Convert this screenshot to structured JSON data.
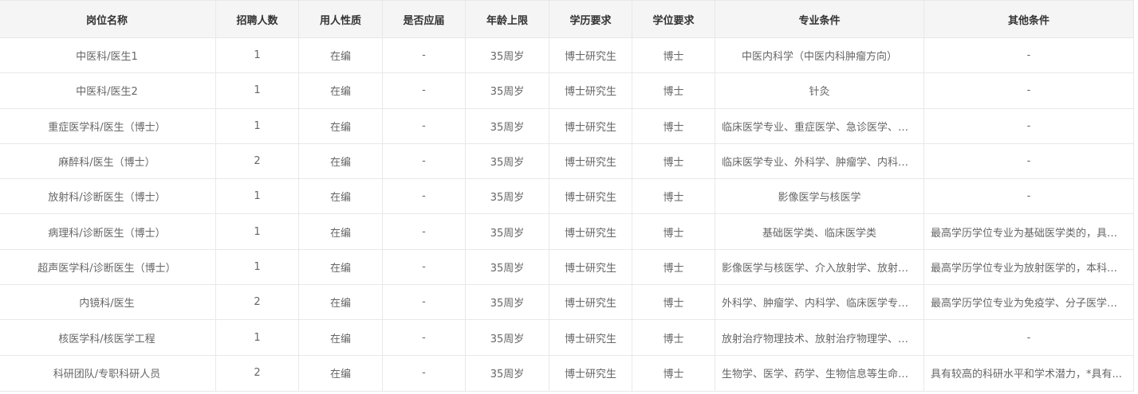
{
  "columns": [
    "岗位名称",
    "招聘人数",
    "用人性质",
    "是否应届",
    "年龄上限",
    "学历要求",
    "学位要求",
    "专业条件",
    "其他条件"
  ],
  "rows": [
    {
      "name": "中医科/医生1",
      "count": "1",
      "nature": "在编",
      "fresh": "-",
      "age": "35周岁",
      "edu": "博士研究生",
      "degree": "博士",
      "major": "中医内科学（中医内科肿瘤方向）",
      "other": "-"
    },
    {
      "name": "中医科/医生2",
      "count": "1",
      "nature": "在编",
      "fresh": "-",
      "age": "35周岁",
      "edu": "博士研究生",
      "degree": "博士",
      "major": "针灸",
      "other": "-"
    },
    {
      "name": "重症医学科/医生（博士）",
      "count": "1",
      "nature": "在编",
      "fresh": "-",
      "age": "35周岁",
      "edu": "博士研究生",
      "degree": "博士",
      "major": "临床医学专业、重症医学、急诊医学、内...",
      "other": "-"
    },
    {
      "name": "麻醉科/医生（博士）",
      "count": "2",
      "nature": "在编",
      "fresh": "-",
      "age": "35周岁",
      "edu": "博士研究生",
      "degree": "博士",
      "major": "临床医学专业、外科学、肿瘤学、内科学...",
      "other": "-"
    },
    {
      "name": "放射科/诊断医生（博士）",
      "count": "1",
      "nature": "在编",
      "fresh": "-",
      "age": "35周岁",
      "edu": "博士研究生",
      "degree": "博士",
      "major": "影像医学与核医学",
      "other": "-"
    },
    {
      "name": "病理科/诊断医生（博士）",
      "count": "1",
      "nature": "在编",
      "fresh": "-",
      "age": "35周岁",
      "edu": "博士研究生",
      "degree": "博士",
      "major": "基础医学类、临床医学类",
      "other": "最高学历学位专业为基础医学类的，具备..."
    },
    {
      "name": "超声医学科/诊断医生（博士）",
      "count": "1",
      "nature": "在编",
      "fresh": "-",
      "age": "35周岁",
      "edu": "博士研究生",
      "degree": "博士",
      "major": "影像医学与核医学、介入放射学、放射影...",
      "other": "最高学历学位专业为放射医学的，本科专..."
    },
    {
      "name": "内镜科/医生",
      "count": "2",
      "nature": "在编",
      "fresh": "-",
      "age": "35周岁",
      "edu": "博士研究生",
      "degree": "博士",
      "major": "外科学、肿瘤学、内科学、临床医学专业...",
      "other": "最高学历学位专业为免疫学、分子医学、..."
    },
    {
      "name": "核医学科/核医学工程",
      "count": "1",
      "nature": "在编",
      "fresh": "-",
      "age": "35周岁",
      "edu": "博士研究生",
      "degree": "博士",
      "major": "放射治疗物理技术、放射治疗物理学、核...",
      "other": "-"
    },
    {
      "name": "科研团队/专职科研人员",
      "count": "2",
      "nature": "在编",
      "fresh": "-",
      "age": "35周岁",
      "edu": "博士研究生",
      "degree": "博士",
      "major": "生物学、医学、药学、生物信息等生命科...",
      "other": "具有较高的科研水平和学术潜力，*具有..."
    }
  ]
}
